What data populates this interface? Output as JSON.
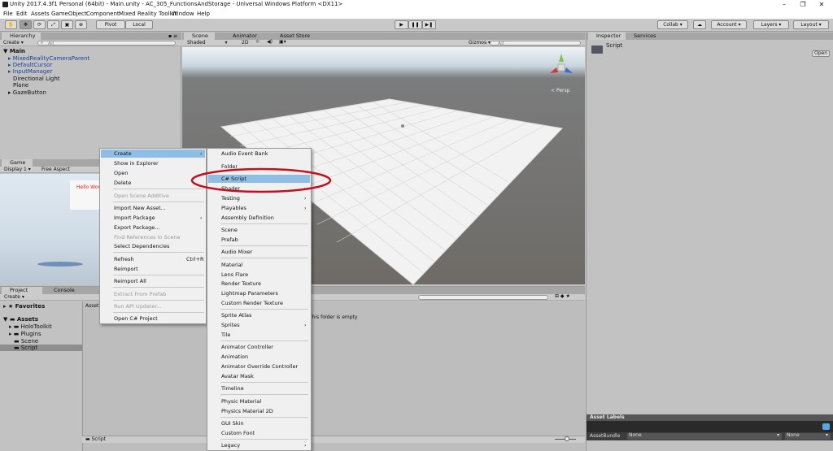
{
  "window": {
    "title": "Unity 2017.4.3f1 Personal (64bit) - Main.unity - AC_305_FunctionsAndStorage - Universal Windows Platform <DX11>",
    "menu": [
      "File",
      "Edit",
      "Assets",
      "GameObject",
      "Component",
      "Mixed Reality Toolkit",
      "Window",
      "Help"
    ]
  },
  "toolbar": {
    "pivot": "Pivot",
    "local": "Local",
    "collab": "Collab",
    "account": "Account",
    "layers": "Layers",
    "layout": "Layout"
  },
  "hierarchy": {
    "tab": "Hierarchy",
    "create": "Create",
    "search_placeholder": "All",
    "scene": "Main",
    "items": [
      "MixedRealityCameraParent",
      "DefaultCursor",
      "InputManager",
      "Directional Light",
      "Plane",
      "GazeButton"
    ]
  },
  "scene_view": {
    "tabs": [
      "Scene",
      "Animator",
      "Asset Store"
    ],
    "shading": "Shaded",
    "mode_2d": "2D",
    "gizmos": "Gizmos",
    "search_placeholder": "All",
    "persp": "Persp"
  },
  "game_view": {
    "tab": "Game",
    "display": "Display 1",
    "aspect": "Free Aspect",
    "hello_text": "Hello Wor"
  },
  "project": {
    "tabs": [
      "Project",
      "Console"
    ],
    "create": "Create",
    "favorites": "Favorites",
    "assets": "Assets",
    "folders": [
      "HoloToolkit",
      "Plugins",
      "Scene",
      "Script"
    ],
    "breadcrumb": "Asset",
    "empty_text": "This folder is empty",
    "footer_path": "Script"
  },
  "inspector": {
    "tabs": [
      "Inspector",
      "Services"
    ],
    "object": "Script",
    "open": "Open",
    "asset_labels": "Asset Labels",
    "asset_bundle": "AssetBundle",
    "bundle_values": [
      "None",
      "None"
    ]
  },
  "context_menu": {
    "items": [
      {
        "label": "Create",
        "submenu": true,
        "highlight": true
      },
      {
        "label": "Show in Explorer"
      },
      {
        "label": "Open"
      },
      {
        "label": "Delete"
      },
      {
        "label": "Open Scene Additive",
        "disabled": true
      },
      {
        "label": "Import New Asset..."
      },
      {
        "label": "Import Package",
        "submenu": true
      },
      {
        "label": "Export Package..."
      },
      {
        "label": "Find References In Scene",
        "disabled": true
      },
      {
        "label": "Select Dependencies"
      },
      {
        "label": "Refresh",
        "shortcut": "Ctrl+R"
      },
      {
        "label": "Reimport"
      },
      {
        "label": "Reimport All"
      },
      {
        "label": "Extract From Prefab",
        "disabled": true
      },
      {
        "label": "Run API Updater...",
        "disabled": true
      },
      {
        "label": "Open C# Project"
      }
    ]
  },
  "create_submenu": {
    "items": [
      {
        "label": "Audio Event Bank"
      },
      {
        "label": "Folder"
      },
      {
        "label": "C# Script",
        "highlight": true
      },
      {
        "label": "Shader",
        "submenu": true
      },
      {
        "label": "Testing",
        "submenu": true
      },
      {
        "label": "Playables",
        "submenu": true
      },
      {
        "label": "Assembly Definition"
      },
      {
        "label": "Scene"
      },
      {
        "label": "Prefab"
      },
      {
        "label": "Audio Mixer"
      },
      {
        "label": "Material"
      },
      {
        "label": "Lens Flare"
      },
      {
        "label": "Render Texture"
      },
      {
        "label": "Lightmap Parameters"
      },
      {
        "label": "Custom Render Texture"
      },
      {
        "label": "Sprite Atlas"
      },
      {
        "label": "Sprites",
        "submenu": true
      },
      {
        "label": "Tile"
      },
      {
        "label": "Animator Controller"
      },
      {
        "label": "Animation"
      },
      {
        "label": "Animator Override Controller"
      },
      {
        "label": "Avatar Mask"
      },
      {
        "label": "Timeline"
      },
      {
        "label": "Physic Material"
      },
      {
        "label": "Physics Material 2D"
      },
      {
        "label": "GUI Skin"
      },
      {
        "label": "Custom Font"
      },
      {
        "label": "Legacy",
        "submenu": true
      }
    ]
  },
  "colors": {
    "highlight": "#8fbde4",
    "annotation": "#c0121c",
    "hierarchy_prefab": "#1f3f9a",
    "hello_red": "#e02020"
  }
}
